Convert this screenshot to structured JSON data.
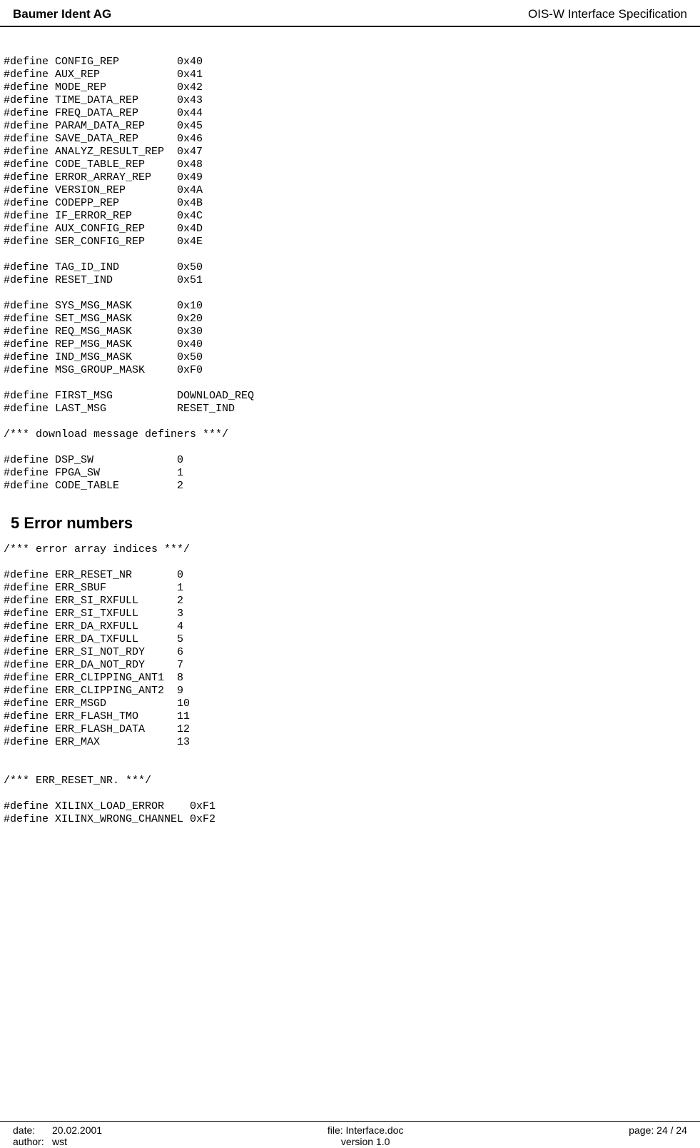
{
  "header": {
    "left": "Baumer Ident AG",
    "right": "OIS-W Interface Specification"
  },
  "section_title": "5  Error numbers",
  "code_block_1": "#define CONFIG_REP         0x40\n#define AUX_REP            0x41\n#define MODE_REP           0x42\n#define TIME_DATA_REP      0x43\n#define FREQ_DATA_REP      0x44\n#define PARAM_DATA_REP     0x45\n#define SAVE_DATA_REP      0x46\n#define ANALYZ_RESULT_REP  0x47\n#define CODE_TABLE_REP     0x48\n#define ERROR_ARRAY_REP    0x49\n#define VERSION_REP        0x4A\n#define CODEPP_REP         0x4B\n#define IF_ERROR_REP       0x4C\n#define AUX_CONFIG_REP     0x4D\n#define SER_CONFIG_REP     0x4E\n\n#define TAG_ID_IND         0x50\n#define RESET_IND          0x51\n\n#define SYS_MSG_MASK       0x10\n#define SET_MSG_MASK       0x20\n#define REQ_MSG_MASK       0x30\n#define REP_MSG_MASK       0x40\n#define IND_MSG_MASK       0x50\n#define MSG_GROUP_MASK     0xF0\n\n#define FIRST_MSG          DOWNLOAD_REQ\n#define LAST_MSG           RESET_IND\n\n/*** download message definers ***/\n\n#define DSP_SW             0\n#define FPGA_SW            1\n#define CODE_TABLE         2",
  "code_block_2": "/*** error array indices ***/\n\n#define ERR_RESET_NR       0\n#define ERR_SBUF           1\n#define ERR_SI_RXFULL      2\n#define ERR_SI_TXFULL      3\n#define ERR_DA_RXFULL      4\n#define ERR_DA_TXFULL      5\n#define ERR_SI_NOT_RDY     6\n#define ERR_DA_NOT_RDY     7\n#define ERR_CLIPPING_ANT1  8\n#define ERR_CLIPPING_ANT2  9\n#define ERR_MSGD           10\n#define ERR_FLASH_TMO      11\n#define ERR_FLASH_DATA     12\n#define ERR_MAX            13\n\n\n/*** ERR_RESET_NR. ***/\n\n#define XILINX_LOAD_ERROR    0xF1\n#define XILINX_WRONG_CHANNEL 0xF2",
  "footer": {
    "date_label": "date:",
    "date_value": "20.02.2001",
    "author_label": "author:",
    "author_value": "wst",
    "file_label": "file: Interface.doc",
    "version_label": "version 1.0",
    "page_label": "page: 24 / 24"
  }
}
